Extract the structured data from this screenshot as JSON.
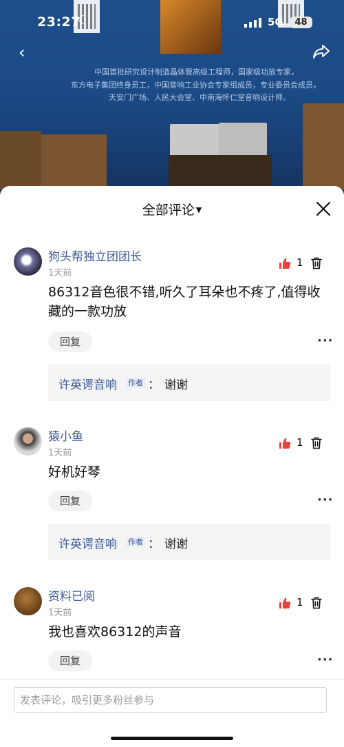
{
  "status_bar": {
    "time": "23:27",
    "network": "5G",
    "battery": "48"
  },
  "poster_lines": [
    "中国首批研究设计制造晶体管高级工程师，国家级功放专家，",
    "东方电子集团终身员工，中国音响工业协会专家组成员，专业委员会成员，",
    "天安门广场、人民大会堂、中南海怀仁堂音响设计师。"
  ],
  "sheet": {
    "title": "全部评论"
  },
  "comments": [
    {
      "user": "狗头帮独立团团长",
      "time": "1天前",
      "text": "86312音色很不错,听久了耳朵也不疼了,值得收藏的一款功放",
      "likes": "1",
      "reply_label": "回复",
      "sub_reply": {
        "user": "许英谔音响",
        "tag": "作者",
        "colon": "：",
        "text": "谢谢"
      }
    },
    {
      "user": "猿小鱼",
      "time": "1天前",
      "text": "好机好琴",
      "likes": "1",
      "reply_label": "回复",
      "sub_reply": {
        "user": "许英谔音响",
        "tag": "作者",
        "colon": "：",
        "text": "谢谢"
      }
    },
    {
      "user": "资料已阅",
      "time": "1天前",
      "text": "我也喜欢86312的声音",
      "likes": "1",
      "reply_label": "回复"
    }
  ],
  "input": {
    "placeholder": "发表评论，吸引更多粉丝参与"
  },
  "colors": {
    "username": "#3b5796",
    "like_red": "#e8423a"
  }
}
